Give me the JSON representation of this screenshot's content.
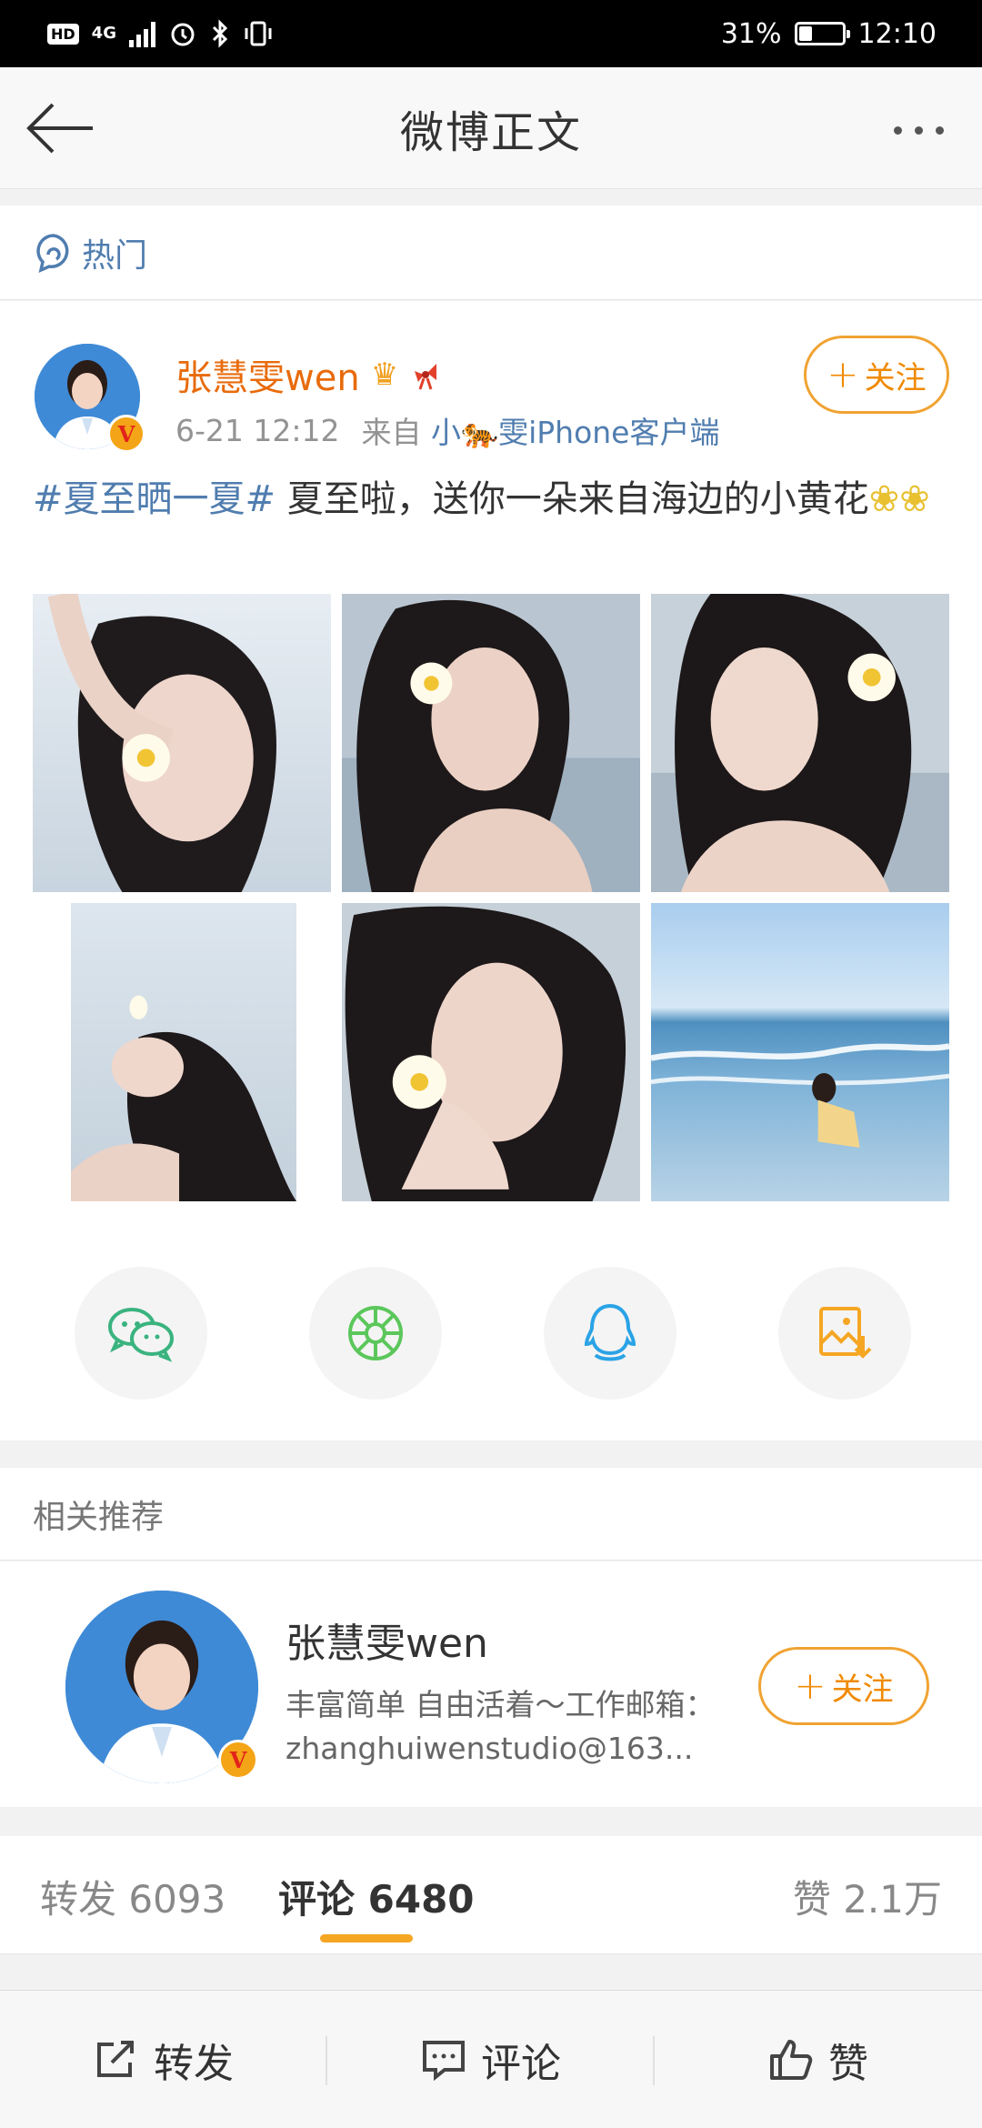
{
  "status_bar": {
    "left_badge": "HD",
    "network": "4G",
    "battery": "31%",
    "battery_level": 0.31,
    "time": "12:10"
  },
  "nav": {
    "title": "微博正文"
  },
  "hot": {
    "label": "热门"
  },
  "post": {
    "author": "张慧雯wen",
    "date": "6-21 12:12",
    "from_label": "来自",
    "source_prefix": "小",
    "source_suffix": "雯iPhone客户端",
    "follow_label": "关注",
    "hashtag": "#夏至晒一夏#",
    "text": " 夏至啦，送你一朵来自海边的小黄花"
  },
  "share": {
    "icons": [
      "wechat-icon",
      "moments-icon",
      "qq-icon",
      "save-image-icon"
    ]
  },
  "recommend": {
    "header": "相关推荐",
    "name": "张慧雯wen",
    "bio": "丰富简单 自由活着～工作邮箱：zhanghuiwenstudio@163...",
    "follow_label": "关注"
  },
  "tabs": {
    "repost": "转发 6093",
    "comment": "评论 6480",
    "like": "赞 2.1万"
  },
  "bottom_bar": {
    "repost": "转发",
    "comment": "评论",
    "like": "赞"
  }
}
